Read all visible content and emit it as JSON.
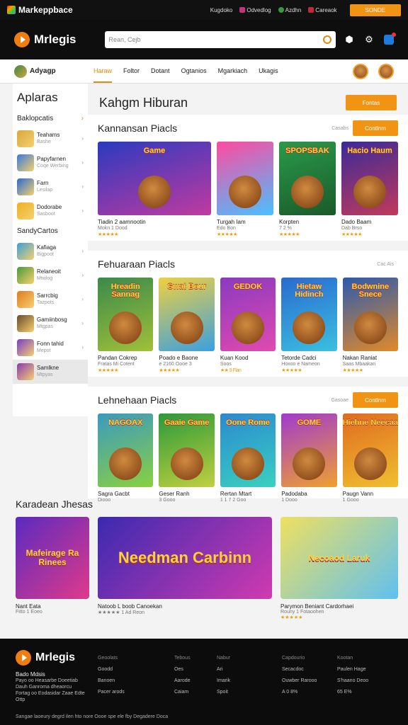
{
  "topbar": {
    "logo": "Markeppbace",
    "links": [
      "Kugdoko",
      "Odvedlog",
      "Azdhn",
      "Careaok"
    ],
    "cta": "SONDE"
  },
  "header": {
    "brand": "Mrlegis",
    "search_placeholder": "Rean, Cejb"
  },
  "nav": {
    "category": "Adyagp",
    "tabs": [
      "Haraw",
      "Foltor",
      "Dotant",
      "Ogtanios",
      "Mgarkiach",
      "Ukagis"
    ],
    "active_tab": "Haraw"
  },
  "sidebar": {
    "title": "Aplaras",
    "section1": "Baklopcatis",
    "section2": "SandyCartos",
    "items": [
      {
        "label": "Teahams",
        "sub": "Bashe",
        "color": "#d8a83a"
      },
      {
        "label": "Papyfarnen",
        "sub": "Coqe Werbing",
        "color": "#3a7ad8"
      },
      {
        "label": "Farn",
        "sub": "Lesilap",
        "color": "#2a6ad0"
      },
      {
        "label": "Dodorabe",
        "sub": "Sasboot",
        "color": "#f0b020"
      },
      {
        "label": "Kafiaga",
        "sub": "Bigpoot",
        "color": "#3aa0d8"
      },
      {
        "label": "Relaneoit",
        "sub": "Mtwlog",
        "color": "#4a9a3a"
      },
      {
        "label": "Sarrcbig",
        "sub": "Tazpots",
        "color": "#e07a20"
      },
      {
        "label": "Gamiinbosg",
        "sub": "Mtgpas",
        "color": "#6a4a2a"
      },
      {
        "label": "Fonn tahid",
        "sub": "Mepot",
        "color": "#7a3ac8"
      },
      {
        "label": "Samlkne",
        "sub": "Mtpyas",
        "color": "#8a3ab0"
      }
    ]
  },
  "main": {
    "title": "Kahgm Hiburan",
    "title_button": "Fontas",
    "sections": [
      {
        "title": "Kannansan Piacls",
        "more": "Casabs",
        "button": "Contlnm",
        "cards": [
          {
            "name": "Tiadin 2 aamnootin",
            "sub": "Mokn 1 Dood",
            "stars": "★★★★★",
            "art": "Game",
            "colorA": "#2a3ac0",
            "colorB": "#c03aa0",
            "wide": true
          },
          {
            "name": "Turgah Iam",
            "sub": "Edo Bon",
            "stars": "★★★★★",
            "art": "",
            "colorA": "#ff4aa0",
            "colorB": "#4ac0ff",
            "wide": false
          },
          {
            "name": "Korpten",
            "sub": "7 2 %",
            "stars": "★★★★★",
            "art": "SPOPSBAK",
            "colorA": "#2a9a4a",
            "colorB": "#1a5a2a",
            "wide": false
          },
          {
            "name": "Dado Baam",
            "sub": "Dab Brso",
            "stars": "★★★★★",
            "art": "Hacio Haum",
            "colorA": "#3a2a9a",
            "colorB": "#c03a5a",
            "wide": false
          }
        ]
      },
      {
        "title": "Fehuaraan Piacls",
        "more": "Cac Ais",
        "button": "",
        "cards": [
          {
            "name": "Pandan Cokrep",
            "sub": "Fratas Mi Cotent",
            "stars": "★★★★★",
            "art": "Hreadin Sannag",
            "colorA": "#3a8a4a",
            "colorB": "#a0c03a",
            "wide": false
          },
          {
            "name": "Poado e Baone",
            "sub": "e 2160 Oooe 3",
            "stars": "★★★★★",
            "art": "Gwat Bour",
            "colorA": "#f0d040",
            "colorB": "#3aa0e0",
            "wide": false
          },
          {
            "name": "Kuan Kood",
            "sub": "Soos",
            "stars": "★★ 9 Flan",
            "art": "GEDOK",
            "colorA": "#8a3ac0",
            "colorB": "#e04ab0",
            "wide": false
          },
          {
            "name": "Tetorde Cadci",
            "sub": "Hoxoo e Nameon",
            "stars": "★★★★★",
            "art": "Hietaw Hidinch",
            "colorA": "#2a6ad0",
            "colorB": "#3ac0e0",
            "wide": false
          },
          {
            "name": "Nakan Raniat",
            "sub": "Saas Mbaakan",
            "stars": "★★★★★",
            "art": "Bodwnine Snece",
            "colorA": "#2a5ab0",
            "colorB": "#e08a2a",
            "wide": false
          }
        ]
      },
      {
        "title": "Lehnehaan Piacls",
        "more": "Gasoae",
        "button": "Contlnm",
        "cards": [
          {
            "name": "Sagra Gacbt",
            "sub": "Diooo",
            "stars": "",
            "art": "NAGOAX",
            "colorA": "#3a9ac0",
            "colorB": "#8ad040",
            "wide": false
          },
          {
            "name": "Geser Ranh",
            "sub": "3 Gooo",
            "stars": "",
            "art": "Gaaie Game",
            "colorA": "#2a9a3a",
            "colorB": "#c0d040",
            "wide": false
          },
          {
            "name": "Rertan Mtart",
            "sub": "1 1 7 2 Goo",
            "stars": "",
            "art": "Oone Rome",
            "colorA": "#2a8ad0",
            "colorB": "#3ad0c0",
            "wide": false
          },
          {
            "name": "Padodaba",
            "sub": "1 Dooo",
            "stars": "",
            "art": "GOME",
            "colorA": "#a03ad0",
            "colorB": "#f0a030",
            "wide": false
          },
          {
            "name": "Paugn Vann",
            "sub": "1 Gooo",
            "stars": "",
            "art": "Hiehne Neecaa",
            "colorA": "#e06a20",
            "colorB": "#f0c030",
            "wide": false
          }
        ]
      }
    ]
  },
  "featured": {
    "title": "Karadean Jhesas",
    "cards": [
      {
        "name": "Nant Eata",
        "sub": "Fitto 1 Eoeo",
        "stars": "",
        "art": "Mafeirage Ra Rinees",
        "colorA": "#5a2ac0",
        "colorB": "#e03a8a",
        "width": 104
      },
      {
        "name": "Natoob L boob Canoekan",
        "sub": "★★★★★ 1 Ad Reon",
        "stars": "★★★★★",
        "art": "Needman Carbinn",
        "colorA": "#3a2ab0",
        "colorB": "#d03ab0",
        "width": 246
      },
      {
        "name": "Parymon Beniant Cardorhaei",
        "sub": "Rouny 1 Fotaoohen",
        "stars": "★★★★★",
        "art": "Necoaod Laruk",
        "colorA": "#f0e060",
        "colorB": "#60c0f0",
        "width": 166
      }
    ]
  },
  "footer": {
    "brand": "Mrlegis",
    "desc_title": "Bado Mdsis",
    "desc": "Payo oo Heasarbe Doeetiab Dauh Ganroma dheaorcu Fortag oo Eodasidar Zaae Edte Ottp",
    "cols": [
      {
        "head": "Geoolats",
        "items": [
          "Goodd",
          "Banoen",
          "Pacer arods"
        ]
      },
      {
        "head": "Tebous",
        "items": [
          "Oes",
          "Aarode",
          "Caiam"
        ]
      },
      {
        "head": "Nabur",
        "items": [
          "Ari",
          "Imarik",
          "Spoit"
        ]
      },
      {
        "head": "Capdourio",
        "items": [
          "Secacdoc",
          "Ouwber Rarooo",
          "A 0 8%"
        ]
      },
      {
        "head": "Kootan",
        "items": [
          "Paulen Hage",
          "S'haano Deoo",
          "65 E%"
        ]
      }
    ],
    "copy": "Sangae laoeury degrd ilen hto nore Oooe spe ele fby Degadere Doca"
  }
}
